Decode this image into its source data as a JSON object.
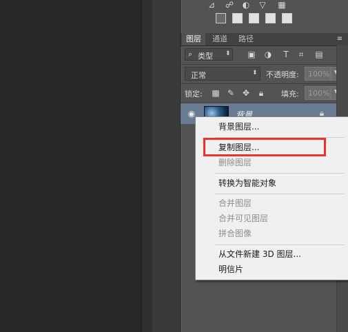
{
  "panel": {
    "tabs": [
      {
        "label": "图层",
        "active": true
      },
      {
        "label": "通道",
        "active": false
      },
      {
        "label": "路径",
        "active": false
      }
    ],
    "filter": {
      "kind_label": "类型",
      "search_glyph": "⌕"
    },
    "blend_mode": {
      "value": "正常"
    },
    "opacity": {
      "label": "不透明度:",
      "value": "100%"
    },
    "lock": {
      "label": "锁定:"
    },
    "fill": {
      "label": "填充:",
      "value": "100%"
    },
    "layer": {
      "name": "背景",
      "visible": true,
      "locked": true
    }
  },
  "context_menu": {
    "items": [
      {
        "label": "背景图层...",
        "enabled": true
      },
      {
        "label": "复制图层...",
        "enabled": true,
        "highlighted": true
      },
      {
        "label": "删除图层",
        "enabled": false
      },
      {
        "label": "转换为智能对象",
        "enabled": true
      },
      {
        "label": "合并图层",
        "enabled": false
      },
      {
        "label": "合并可见图层",
        "enabled": false
      },
      {
        "label": "拼合图像",
        "enabled": false
      },
      {
        "label": "从文件新建 3D 图层...",
        "enabled": true
      },
      {
        "label": "明信片",
        "enabled": true
      }
    ]
  },
  "colors": {
    "highlight_box": "#f0302c",
    "panel_bg": "#535353",
    "selected_layer": "#6a7a92"
  }
}
